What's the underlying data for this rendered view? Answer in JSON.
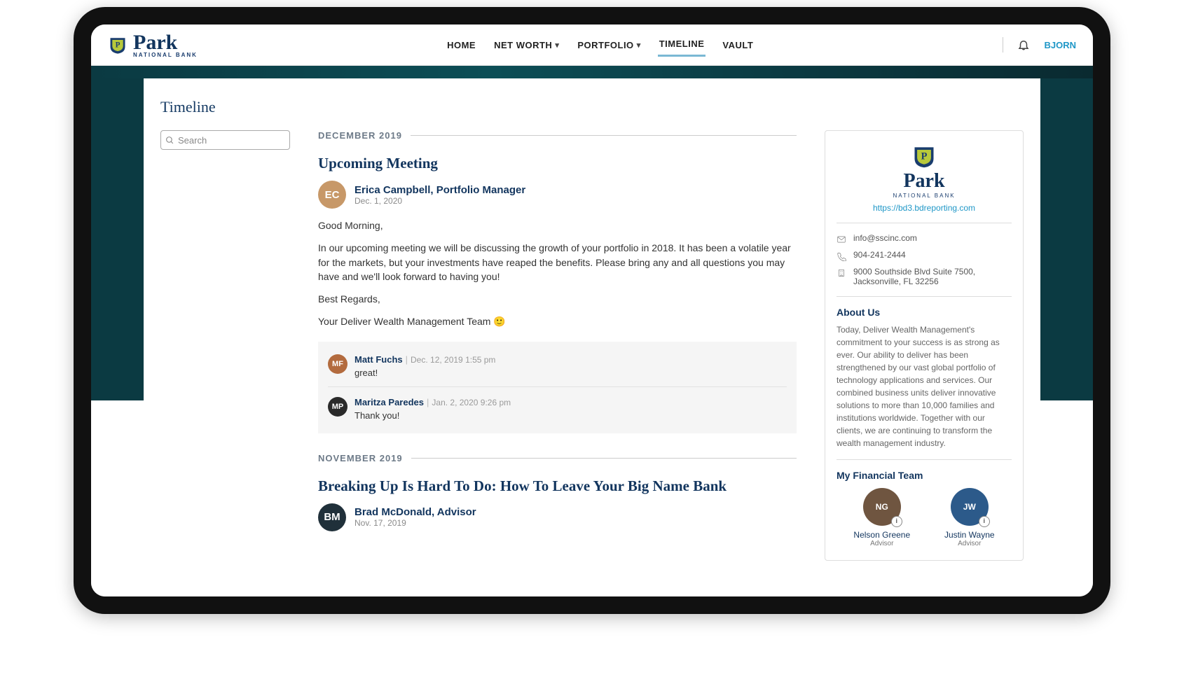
{
  "brand": {
    "name": "Park",
    "sub": "NATIONAL BANK"
  },
  "nav": {
    "items": [
      {
        "label": "HOME",
        "dropdown": false,
        "active": false
      },
      {
        "label": "NET WORTH",
        "dropdown": true,
        "active": false
      },
      {
        "label": "PORTFOLIO",
        "dropdown": true,
        "active": false
      },
      {
        "label": "TIMELINE",
        "dropdown": false,
        "active": true
      },
      {
        "label": "VAULT",
        "dropdown": false,
        "active": false
      }
    ],
    "user": "BJORN"
  },
  "page": {
    "title": "Timeline",
    "search_placeholder": "Search"
  },
  "sections": [
    {
      "label": "DECEMBER 2019",
      "post": {
        "title": "Upcoming Meeting",
        "author": "Erica Campbell, Portfolio Manager",
        "avatar_color": "#c79868",
        "avatar_initials": "EC",
        "date": "Dec. 1, 2020",
        "body": [
          "Good Morning,",
          "In our upcoming meeting we will be discussing the growth of your portfolio in 2018. It has been a volatile year for the markets, but your investments have reaped the benefits. Please bring any and all questions you may have and we'll look forward to having you!",
          "Best Regards,",
          "Your Deliver Wealth Management Team 🙂"
        ],
        "replies": [
          {
            "name": "Matt Fuchs",
            "avatar_color": "#b36b3e",
            "avatar_initials": "MF",
            "meta": "Dec. 12, 2019  1:55 pm",
            "body": "great!"
          },
          {
            "name": "Maritza Paredes",
            "avatar_color": "#2a2a2a",
            "avatar_initials": "MP",
            "meta": "Jan. 2, 2020 9:26 pm",
            "body": "Thank you!"
          }
        ]
      }
    },
    {
      "label": "NOVEMBER 2019",
      "post": {
        "title": "Breaking Up Is Hard To Do: How To Leave Your Big Name Bank",
        "author": "Brad McDonald, Advisor",
        "avatar_color": "#20303a",
        "avatar_initials": "BM",
        "date": "Nov. 17, 2019",
        "body": [],
        "replies": []
      }
    }
  ],
  "sidebar": {
    "link": "https://bd3.bdreporting.com",
    "email": "info@sscinc.com",
    "phone": "904-241-2444",
    "address": "9000 Southside Blvd Suite 7500, Jacksonville, FL 32256",
    "about_h": "About Us",
    "about": "Today, Deliver Wealth Management's commitment to your success is as strong as ever. Our ability to deliver has been strengthened by our vast global portfolio of technology applications and services. Our combined business units deliver innovative solutions to more than 10,000 families and institutions worldwide. Together with our clients, we are continuing to transform the wealth management industry.",
    "team_h": "My Financial Team",
    "team": [
      {
        "name": "Nelson Greene",
        "role": "Advisor",
        "color": "#6f5540"
      },
      {
        "name": "Justin Wayne",
        "role": "Advisor",
        "color": "#2c5a8a"
      }
    ]
  }
}
